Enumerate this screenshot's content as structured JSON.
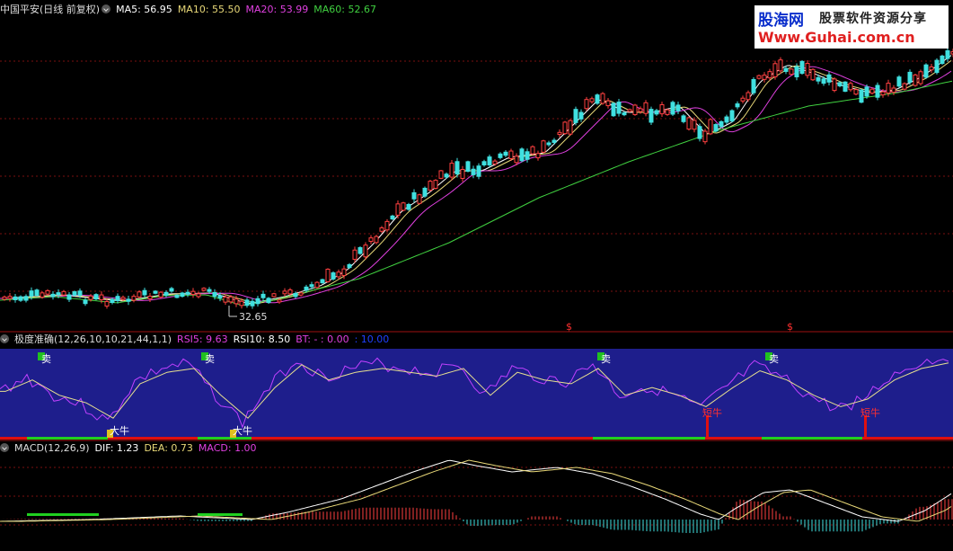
{
  "panel1": {
    "title": "中国平安(日线 前复权)",
    "ma5": "MA5: 56.95",
    "ma10": "MA10: 55.50",
    "ma20": "MA20: 53.99",
    "ma60": "MA60: 52.67",
    "low_label": "32.65",
    "marker1": "$",
    "marker2": "$"
  },
  "panel2": {
    "title": "极度准确(12,26,10,10,21,44,1,1)",
    "rsi5": "RSI5: 9.63",
    "rsi10": "RSI10: 8.50",
    "bt": "BT: - : 0.00",
    "val": ": 10.00",
    "sell": "卖",
    "big_bull": "大牛",
    "short_bull": "短牛"
  },
  "panel3": {
    "title": "MACD(12,26,9)",
    "dif": "DIF: 1.23",
    "dea": "DEA: 0.73",
    "macd": "MACD: 1.00"
  },
  "watermark": {
    "brand": "股海网",
    "slogan": "股票软件资源分享",
    "url": "Www.Guhai.com.cn"
  },
  "colors": {
    "ma5": "#ffffff",
    "ma10": "#e8d878",
    "ma20": "#e040e0",
    "ma60": "#40d040",
    "up": "#ff4040",
    "down": "#40e0e0",
    "rsi_bg": "#1e1e8c"
  },
  "chart_data": [
    {
      "type": "candlestick",
      "title": "中国平安(日线 前复权)",
      "series": [
        {
          "name": "MA5",
          "last": 56.95
        },
        {
          "name": "MA10",
          "last": 55.5
        },
        {
          "name": "MA20",
          "last": 53.99
        },
        {
          "name": "MA60",
          "last": 52.67
        }
      ],
      "annotations": [
        {
          "text": "32.65"
        }
      ]
    },
    {
      "type": "line",
      "title": "极度准确(12,26,10,10,21,44,1,1)",
      "series": [
        {
          "name": "RSI5",
          "last": 9.63
        },
        {
          "name": "RSI10",
          "last": 8.5
        }
      ],
      "annotations": [
        {
          "text": "卖"
        },
        {
          "text": "大牛"
        },
        {
          "text": "短牛"
        }
      ]
    },
    {
      "type": "line",
      "title": "MACD(12,26,9)",
      "series": [
        {
          "name": "DIF",
          "last": 1.23
        },
        {
          "name": "DEA",
          "last": 0.73
        },
        {
          "name": "MACD",
          "last": 1.0
        }
      ]
    }
  ]
}
